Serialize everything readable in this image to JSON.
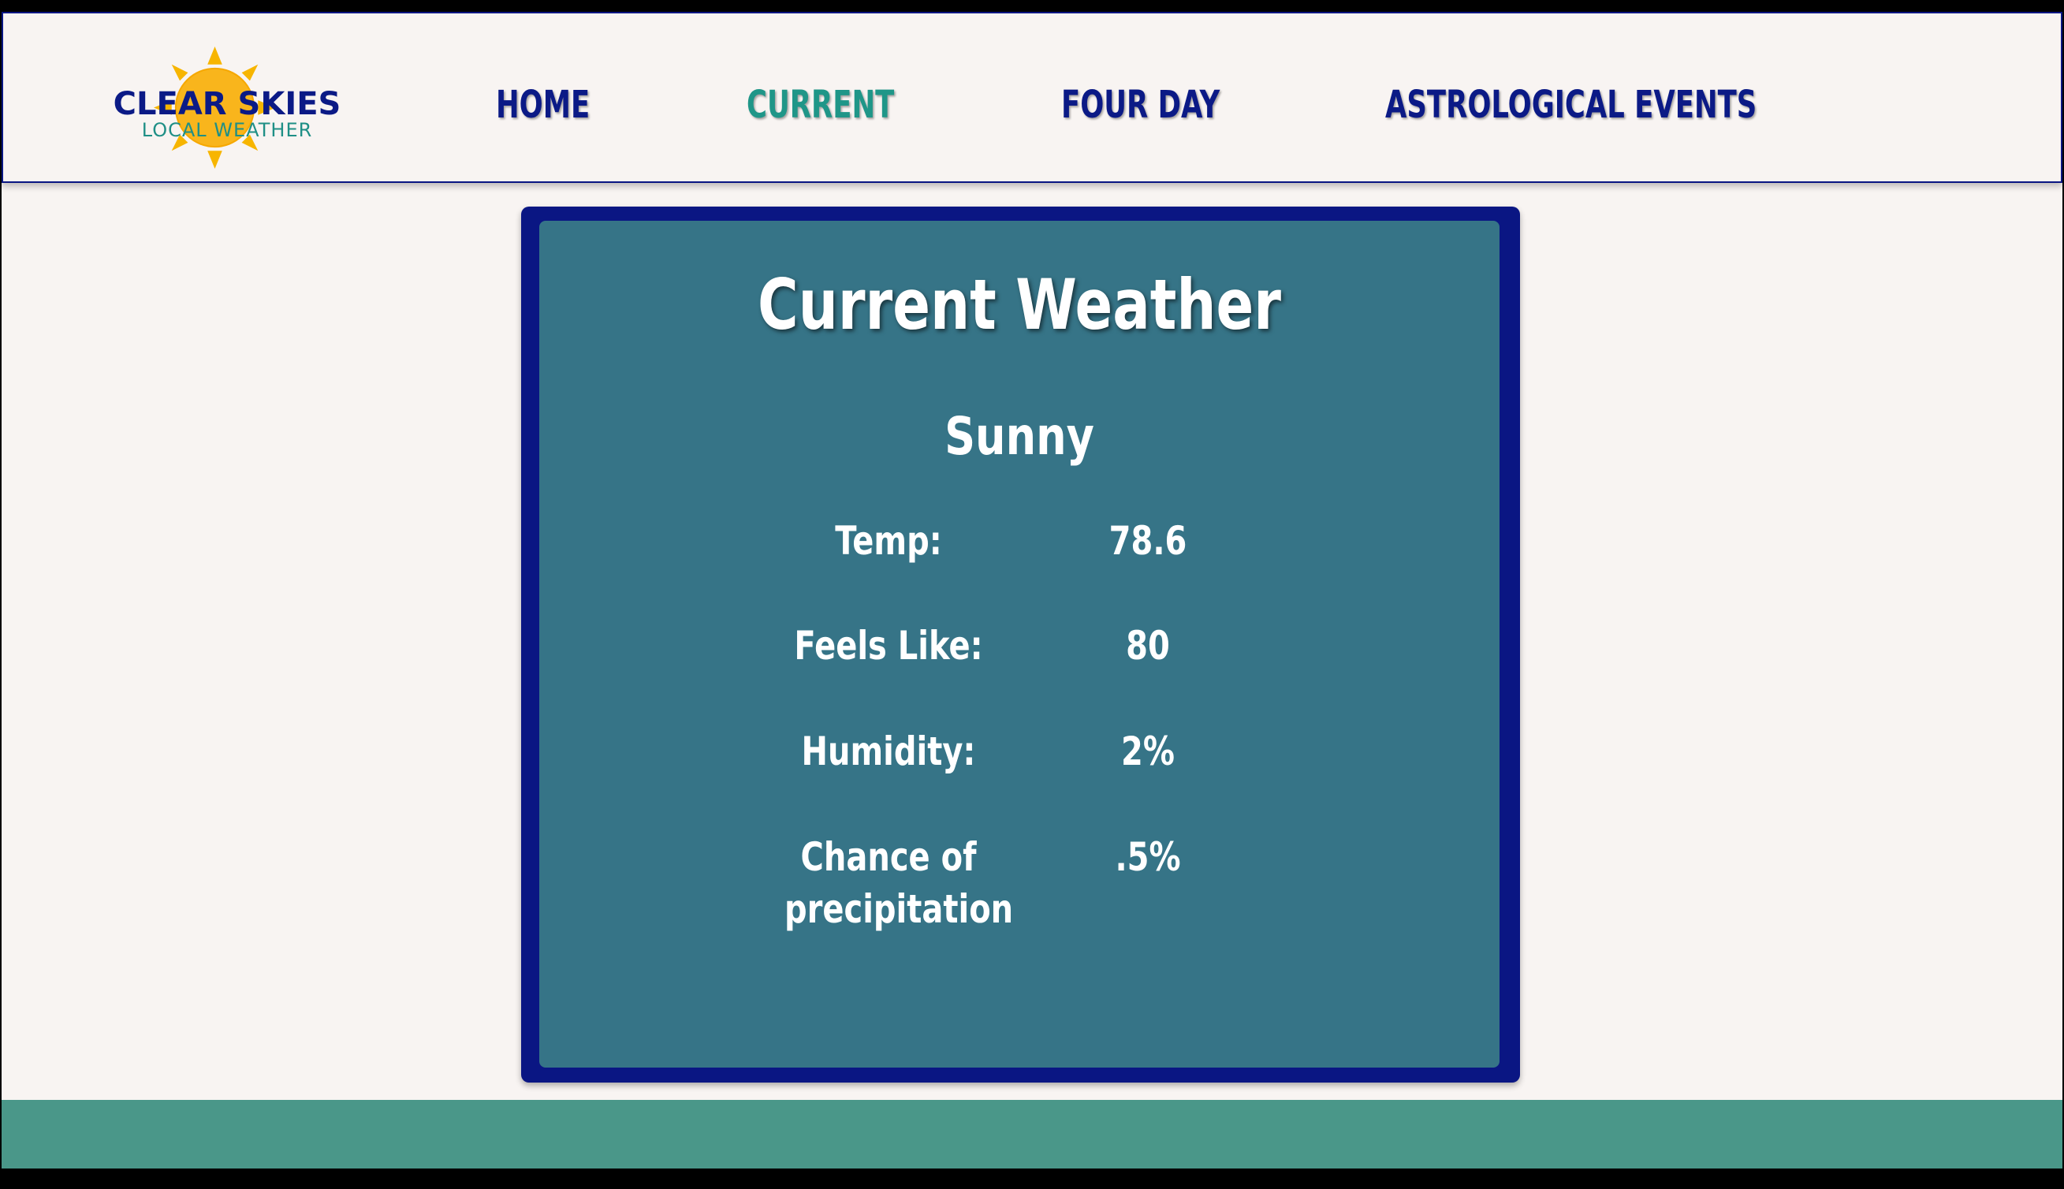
{
  "logo": {
    "title": "CLEAR SKIES",
    "subtitle": "LOCAL WEATHER",
    "sun_color": "#f7b500"
  },
  "nav": {
    "items": [
      {
        "label": "HOME",
        "active": false
      },
      {
        "label": "CURRENT",
        "active": true
      },
      {
        "label": "FOUR DAY",
        "active": false
      },
      {
        "label": "ASTROLOGICAL EVENTS",
        "active": false
      }
    ]
  },
  "current": {
    "title": "Current Weather",
    "condition": "Sunny",
    "rows": [
      {
        "label": "Temp:",
        "value": "78.6"
      },
      {
        "label": "Feels Like:",
        "value": "80"
      },
      {
        "label": "Humidity:",
        "value": "2%"
      },
      {
        "label": "Chance of precipitation",
        "value": ".5%"
      }
    ]
  },
  "colors": {
    "navy": "#0a1683",
    "teal_active": "#1f9688",
    "card_background": "#367487",
    "footer": "#4a9789",
    "page_background": "#f8f4f2"
  }
}
